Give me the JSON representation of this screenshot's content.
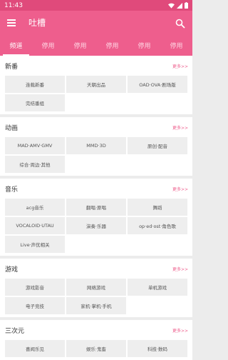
{
  "status": {
    "time": "11:43"
  },
  "appbar": {
    "title": "吐槽",
    "menu_icon": "menu-icon",
    "search_icon": "search-icon"
  },
  "tabs": [
    {
      "label": "频道",
      "active": true
    },
    {
      "label": "停用"
    },
    {
      "label": "停用"
    },
    {
      "label": "停用"
    },
    {
      "label": "停用"
    },
    {
      "label": "停用"
    }
  ],
  "sections": [
    {
      "title": "新番",
      "more": "更多>>",
      "items": [
        "连载新番",
        "天朝出品",
        "OAD·OVA·剧场版",
        "完结番组"
      ]
    },
    {
      "title": "动画",
      "more": "更多>>",
      "items": [
        "MAD·AMV·GMV",
        "MMD·3D",
        "原创·配音",
        "综合·周边·其他"
      ]
    },
    {
      "title": "音乐",
      "more": "更多>>",
      "items": [
        "acg音乐",
        "翻唱·原唱",
        "舞蹈",
        "VOCALOID·UTAU",
        "演奏·乐器",
        "op·ed·ost·角色歌",
        "Live·声优相关"
      ]
    },
    {
      "title": "游戏",
      "more": "更多>>",
      "items": [
        "游戏影音",
        "网络游戏",
        "单机游戏",
        "电子竞技",
        "家机·掌机·手机"
      ]
    },
    {
      "title": "三次元",
      "more": "更多>>",
      "items": [
        "喜闻乐见",
        "娱乐·鬼畜",
        "科技·数码"
      ]
    }
  ]
}
